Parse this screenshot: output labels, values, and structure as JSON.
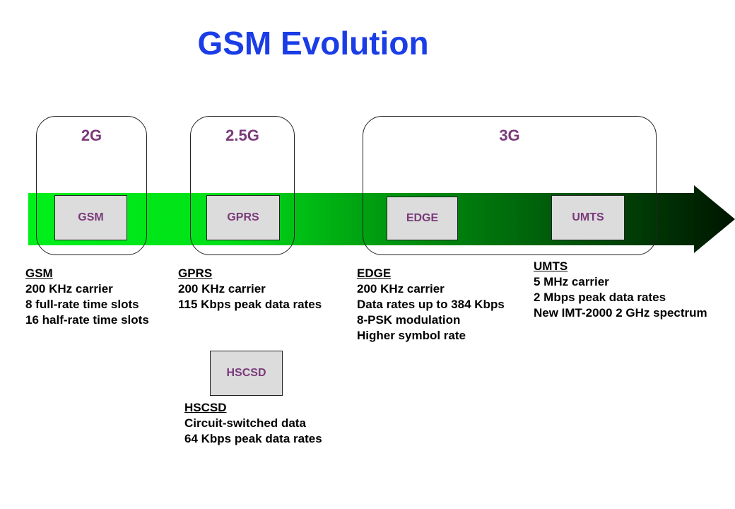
{
  "title": "GSM Evolution",
  "colors": {
    "title": "#1a3de6",
    "labels": "#7a3a7a",
    "arrow_start": "#00f01a",
    "arrow_end": "#001a00",
    "box_fill": "#dcdcdc"
  },
  "groups": [
    {
      "label": "2G"
    },
    {
      "label": "2.5G"
    },
    {
      "label": "3G"
    }
  ],
  "technologies": [
    {
      "label": "GSM"
    },
    {
      "label": "GPRS"
    },
    {
      "label": "EDGE"
    },
    {
      "label": "UMTS"
    },
    {
      "label": "HSCSD"
    }
  ],
  "descriptions": [
    {
      "heading": "GSM",
      "lines": [
        "200 KHz carrier",
        "8 full-rate time slots",
        "16 half-rate time slots"
      ]
    },
    {
      "heading": "GPRS",
      "lines": [
        "200 KHz carrier",
        "115 Kbps peak data rates"
      ]
    },
    {
      "heading": "EDGE",
      "lines": [
        "200 KHz carrier",
        "Data rates up to 384 Kbps",
        "8-PSK modulation",
        "Higher symbol rate"
      ]
    },
    {
      "heading": "UMTS",
      "lines": [
        "5 MHz carrier",
        "2 Mbps peak data rates",
        "New IMT-2000 2 GHz spectrum"
      ]
    },
    {
      "heading": "HSCSD",
      "lines": [
        "Circuit-switched data",
        "64 Kbps peak data rates"
      ]
    }
  ]
}
